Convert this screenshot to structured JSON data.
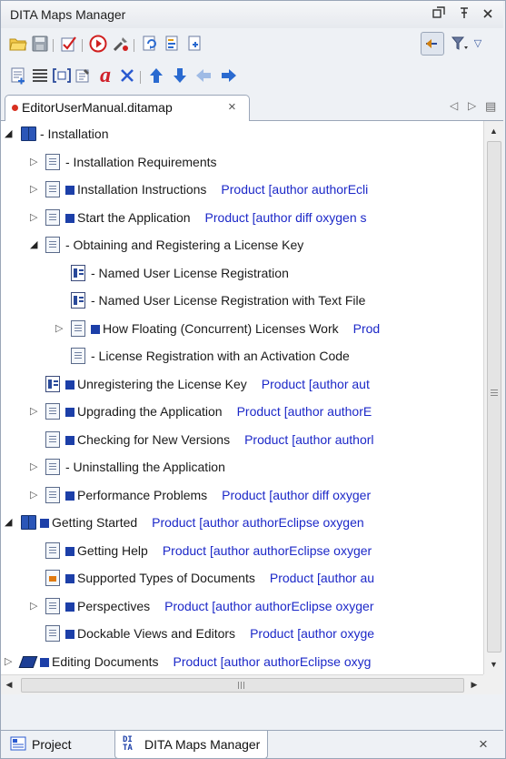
{
  "window": {
    "title": "DITA Maps Manager",
    "buttons": [
      "restore-icon",
      "pin-icon",
      "close-icon"
    ]
  },
  "toolbar1": {
    "icons": [
      "open-folder-icon",
      "save-icon",
      "validate-icon",
      "run-transformation-icon",
      "configure-transformation-icon",
      "refresh-references-icon",
      "open-map-icon",
      "new-map-icon"
    ],
    "right_icons": [
      "link-with-editor-icon",
      "filter-icon",
      "view-menu-icon"
    ]
  },
  "toolbar2": {
    "icons": [
      "new-topic-icon",
      "insert-reference-icon",
      "insert-topic-group-icon",
      "edit-properties-icon",
      "edit-attributes-icon",
      "delete-icon",
      "move-up-icon",
      "move-down-icon",
      "promote-icon",
      "demote-icon"
    ]
  },
  "tab": {
    "label": "EditorUserManual.ditamap",
    "close": "×",
    "nav_left": "◁",
    "nav_right": "▷",
    "menu": "▤"
  },
  "tree": [
    {
      "indent": 0,
      "arrow": "open",
      "icon": "book",
      "square": false,
      "label": "- Installation",
      "meta": ""
    },
    {
      "indent": 1,
      "arrow": "closed",
      "icon": "doc",
      "square": false,
      "label": "- Installation Requirements",
      "meta": ""
    },
    {
      "indent": 1,
      "arrow": "closed",
      "icon": "doc",
      "square": true,
      "label": "Installation Instructions",
      "meta": "Product [author authorEcli"
    },
    {
      "indent": 1,
      "arrow": "closed",
      "icon": "doc",
      "square": true,
      "label": "Start the Application",
      "meta": "Product [author diff oxygen s"
    },
    {
      "indent": 1,
      "arrow": "open",
      "icon": "doc",
      "square": false,
      "label": "- Obtaining and Registering a License Key",
      "meta": ""
    },
    {
      "indent": 2,
      "arrow": "none",
      "icon": "task",
      "square": false,
      "label": "- Named User License Registration",
      "meta": ""
    },
    {
      "indent": 2,
      "arrow": "none",
      "icon": "task",
      "square": false,
      "label": "- Named User License Registration with Text File",
      "meta": ""
    },
    {
      "indent": 2,
      "arrow": "closed",
      "icon": "doc",
      "square": true,
      "label": "How Floating (Concurrent) Licenses Work",
      "meta": "Prod"
    },
    {
      "indent": 2,
      "arrow": "none",
      "icon": "doc",
      "square": false,
      "label": "- License Registration with an Activation Code",
      "meta": ""
    },
    {
      "indent": 1,
      "arrow": "none",
      "icon": "task",
      "square": true,
      "label": "Unregistering the License Key",
      "meta": "Product [author aut"
    },
    {
      "indent": 1,
      "arrow": "closed",
      "icon": "doc",
      "square": true,
      "label": "Upgrading the Application",
      "meta": "Product [author authorE"
    },
    {
      "indent": 1,
      "arrow": "none",
      "icon": "doc",
      "square": true,
      "label": "Checking for New Versions",
      "meta": "Product [author authorl"
    },
    {
      "indent": 1,
      "arrow": "closed",
      "icon": "doc",
      "square": false,
      "label": "- Uninstalling the Application",
      "meta": ""
    },
    {
      "indent": 1,
      "arrow": "closed",
      "icon": "doc",
      "square": true,
      "label": "Performance Problems",
      "meta": "Product [author diff oxyger"
    },
    {
      "indent": 0,
      "arrow": "open",
      "icon": "book",
      "square": true,
      "label": "Getting Started",
      "meta": "Product [author authorEclipse oxygen"
    },
    {
      "indent": 1,
      "arrow": "none",
      "icon": "doc",
      "square": true,
      "label": "Getting Help",
      "meta": "Product [author authorEclipse oxyger"
    },
    {
      "indent": 1,
      "arrow": "none",
      "icon": "orange",
      "square": true,
      "label": "Supported Types of Documents",
      "meta": "Product [author au"
    },
    {
      "indent": 1,
      "arrow": "closed",
      "icon": "doc",
      "square": true,
      "label": "Perspectives",
      "meta": "Product [author authorEclipse oxyger"
    },
    {
      "indent": 1,
      "arrow": "none",
      "icon": "doc",
      "square": true,
      "label": "Dockable Views and Editors",
      "meta": "Product [author oxyge"
    },
    {
      "indent": 0,
      "arrow": "closed",
      "icon": "closedbook",
      "square": true,
      "label": "Editing Documents",
      "meta": "Product [author authorEclipse oxyg"
    }
  ],
  "scrollbar": {
    "up": "▲",
    "down": "▼",
    "left": "◀",
    "right": "▶"
  },
  "bottom_tabs": [
    {
      "label": "Project",
      "icon": "project-icon"
    },
    {
      "label": "DITA Maps Manager",
      "icon": "dita-icon",
      "badge": "DI TA"
    }
  ],
  "bottom_close": "×"
}
